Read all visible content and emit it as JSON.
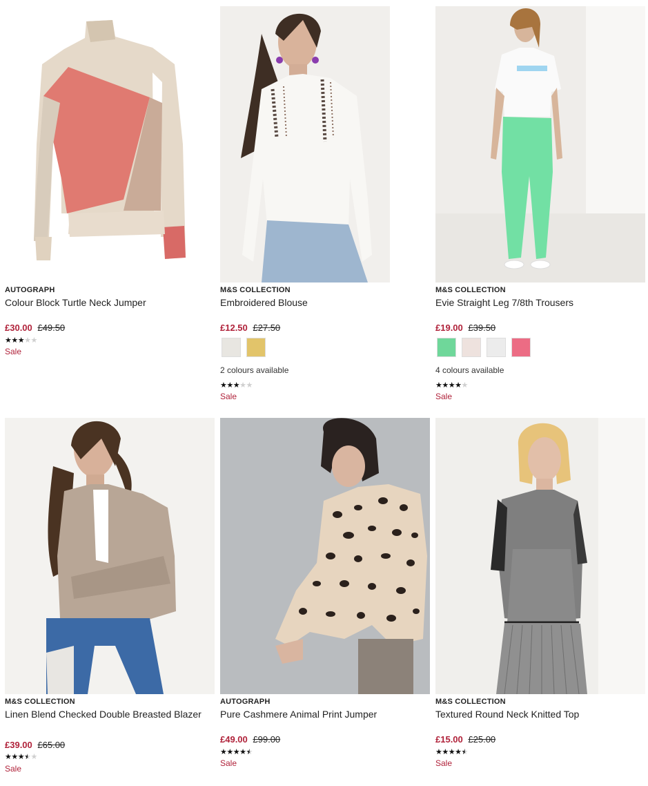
{
  "products": [
    {
      "brand": "AUTOGRAPH",
      "title": "Colour Block Turtle Neck Jumper",
      "price_now": "£30.00",
      "price_was": "£49.50",
      "rating": 3,
      "sale": "Sale",
      "image": "colour-block-jumper",
      "swatches": [],
      "colours_text": ""
    },
    {
      "brand": "M&S COLLECTION",
      "title": "Embroidered Blouse",
      "price_now": "£12.50",
      "price_was": "£27.50",
      "rating": 3,
      "sale": "Sale",
      "image": "embroidered-blouse",
      "swatches": [
        "#e8e6e1",
        "#e2c46a"
      ],
      "colours_text": "2 colours available"
    },
    {
      "brand": "M&S COLLECTION",
      "title": "Evie Straight Leg 7/8th Trousers",
      "price_now": "£19.00",
      "price_was": "£39.50",
      "rating": 4,
      "sale": "Sale",
      "image": "green-trousers",
      "swatches": [
        "#6fd79a",
        "#eee2de",
        "#ececec",
        "#ec6c84"
      ],
      "colours_text": "4 colours available"
    },
    {
      "brand": "M&S COLLECTION",
      "title": "Linen Blend Checked Double Breasted Blazer",
      "price_now": "£39.00",
      "price_was": "£65.00",
      "rating": 3.5,
      "sale": "Sale",
      "image": "checked-blazer",
      "swatches": [],
      "colours_text": ""
    },
    {
      "brand": "AUTOGRAPH",
      "title": "Pure Cashmere Animal Print Jumper",
      "price_now": "£49.00",
      "price_was": "£99.00",
      "rating": 4.5,
      "sale": "Sale",
      "image": "animal-print-jumper",
      "swatches": [],
      "colours_text": ""
    },
    {
      "brand": "M&S COLLECTION",
      "title": "Textured Round Neck Knitted Top",
      "price_now": "£15.00",
      "price_was": "£25.00",
      "rating": 4.5,
      "sale": "Sale",
      "image": "knitted-top",
      "swatches": [],
      "colours_text": ""
    }
  ],
  "colors": {
    "sale_red": "#b0223a",
    "star_filled": "#111111",
    "star_empty": "#cfcfcf"
  }
}
